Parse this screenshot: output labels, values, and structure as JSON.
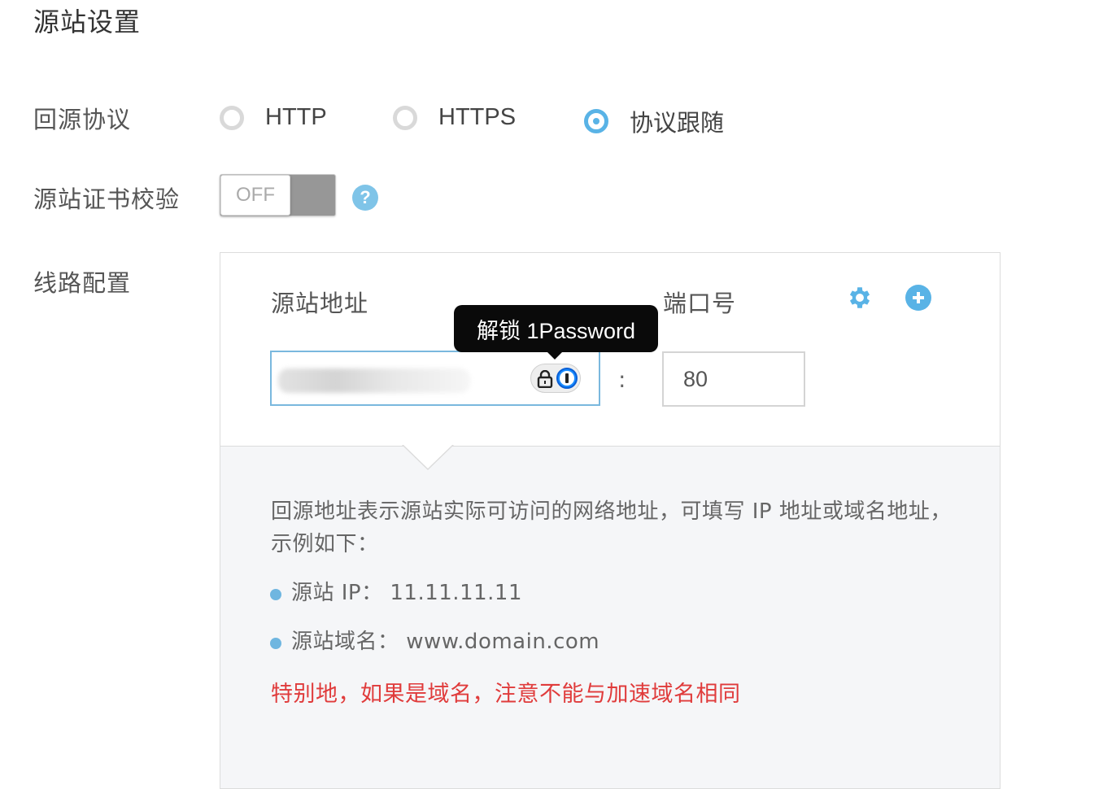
{
  "section_title": "源站设置",
  "origin_protocol": {
    "label": "回源协议",
    "options": [
      "HTTP",
      "HTTPS",
      "协议跟随"
    ],
    "selected": "协议跟随"
  },
  "cert_check": {
    "label": "源站证书校验",
    "toggle_text": "OFF",
    "help_text": "?"
  },
  "line_config": {
    "label": "线路配置",
    "address_header": "源站地址",
    "port_header": "端口号",
    "separator": ":",
    "port_value": "80",
    "tooltip": "解锁 1Password",
    "description": "回源地址表示源站实际可访问的网络地址，可填写 IP 地址或域名地址，示例如下：",
    "examples": [
      "源站 IP： 11.11.11.11",
      "源站域名： www.domain.com"
    ],
    "warning": "特别地，如果是域名，注意不能与加速域名相同"
  },
  "colors": {
    "accent": "#59b3e6",
    "warning": "#e03b3b",
    "tooltip_bg": "#0a0a0a"
  },
  "icons": [
    "question-icon",
    "gear-icon",
    "plus-circle-icon",
    "lock-icon",
    "onepassword-icon"
  ]
}
